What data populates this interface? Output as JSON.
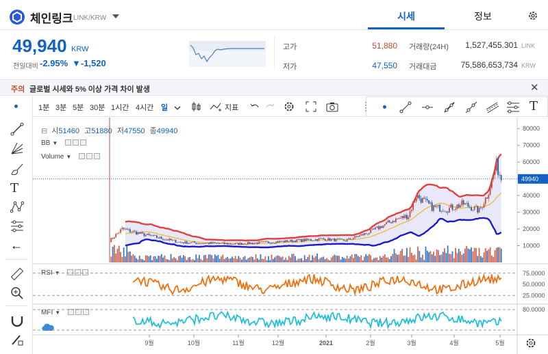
{
  "header": {
    "coin_name": "체인링크",
    "coin_code": "LINK/KRW",
    "tabs": [
      {
        "label": "시세"
      },
      {
        "label": "정보"
      }
    ]
  },
  "summary": {
    "price": "49,940",
    "price_unit": "KRW",
    "change_label": "전일대비",
    "change_pct": "-2.95%",
    "change_amt": "▼-1,520",
    "high_label": "고가",
    "high": "51,880",
    "low_label": "저가",
    "low": "47,550",
    "volume_label": "거래량(24H)",
    "volume": "1,527,455.301",
    "volume_unit": "LINK",
    "amount_label": "거래대금",
    "amount": "75,586,653,734",
    "amount_unit": "KRW"
  },
  "notice": {
    "tag": "주의",
    "text": "글로벌 시세와 5% 이상 가격 차이 발생"
  },
  "toolbar": {
    "intervals": [
      "1분",
      "3분",
      "5분",
      "30분",
      "1시간",
      "4시간",
      "일"
    ],
    "indicator_label": "지표"
  },
  "legend": {
    "open_label": "시",
    "open": "51460",
    "high_label": "고",
    "high": "51880",
    "low_label": "저",
    "low": "47550",
    "close_label": "종",
    "close": "49940"
  },
  "indicators": {
    "bb": "BB",
    "volume": "Volume",
    "rsi": "RSI",
    "mfi": "MFI"
  },
  "chart_data": {
    "type": "candlestick",
    "price_axis_ticks": [
      "80000",
      "70000",
      "60000",
      "50000",
      "40000",
      "30000",
      "20000",
      "10000"
    ],
    "current_price_label": "49940",
    "rsi_axis_ticks": [
      "75.0000",
      "50.0000",
      "25.0000"
    ],
    "mfi_axis_ticks": [
      "80.0000"
    ],
    "x_ticks": [
      "9월",
      "10월",
      "11월",
      "12월",
      "2021",
      "2월",
      "3월",
      "4월",
      "5월"
    ],
    "ylim": [
      0,
      85000
    ]
  },
  "colors": {
    "accent": "#1261c4",
    "up": "#c84a31",
    "down": "#1261c4",
    "bb_upper": "#e04040",
    "bb_lower": "#1a1acc",
    "bb_mid": "#e8c040",
    "rsi": "#f07010",
    "mfi": "#20c0d8"
  }
}
